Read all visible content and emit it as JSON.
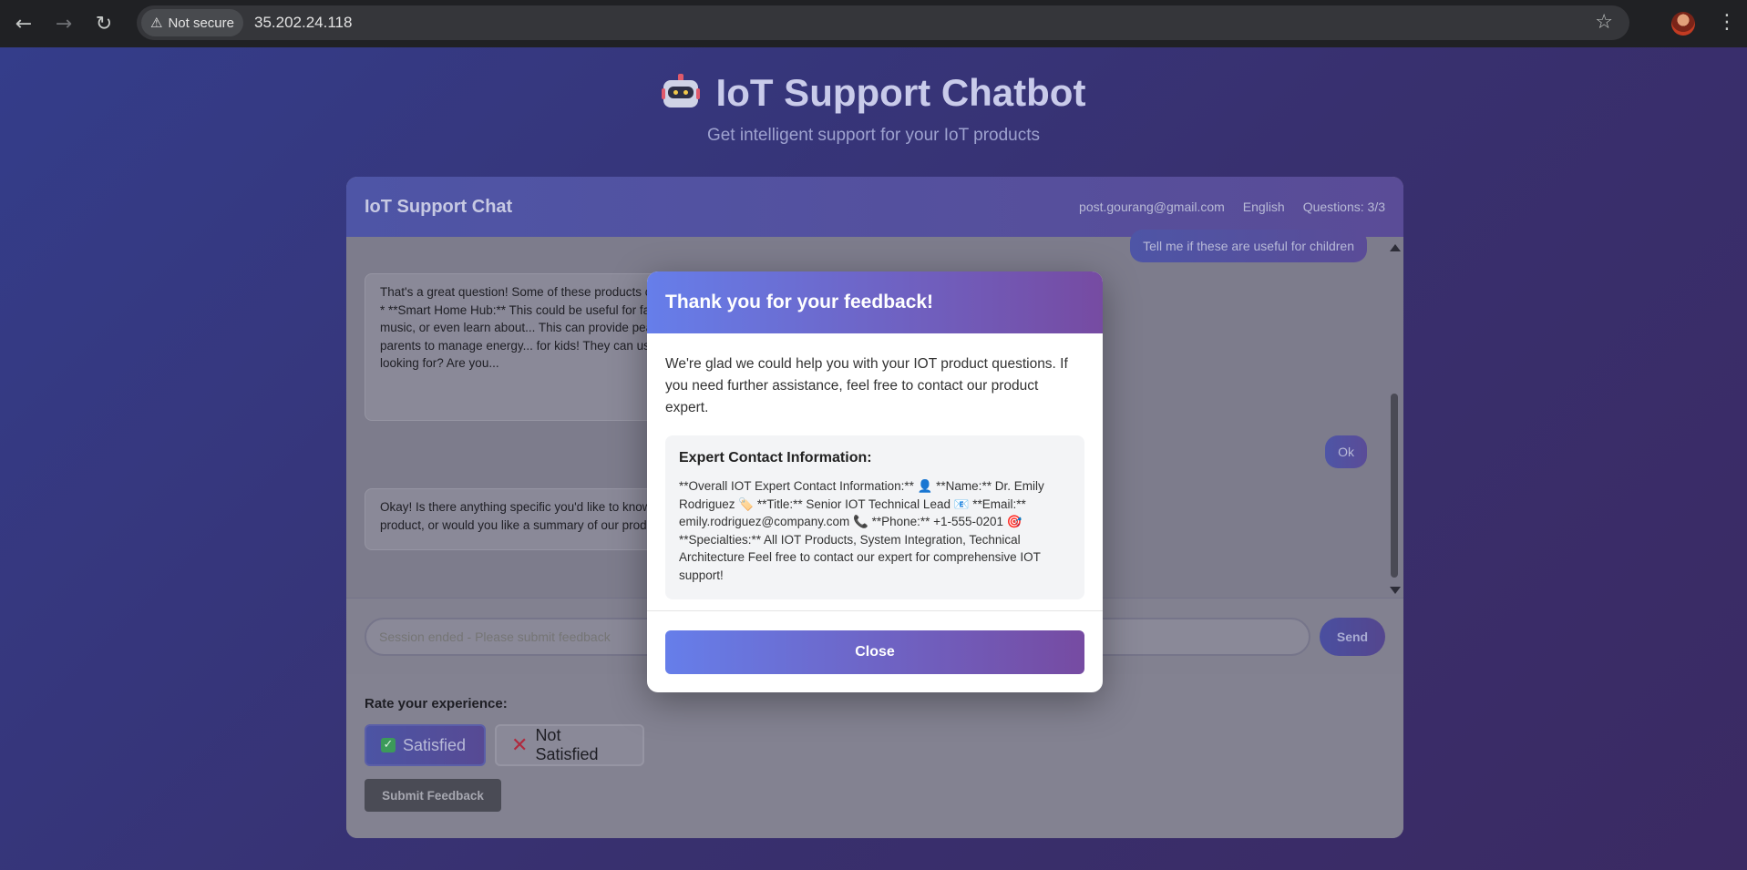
{
  "browser": {
    "security_label": "Not secure",
    "url": "35.202.24.118"
  },
  "app": {
    "title": "IoT Support Chatbot",
    "subtitle": "Get intelligent support for your IoT products"
  },
  "chat": {
    "title": "IoT Support Chat",
    "user_email": "post.gourang@gmail.com",
    "language": "English",
    "questions": "Questions: 3/3",
    "messages": [
      {
        "role": "user",
        "text": "Tell me if these are useful for children"
      },
      {
        "role": "bot",
        "text": "That's a great question! Some of these products can be useful for children depending on your family's needs. * **Smart Home Hub:** This could be useful for families with children - you could use it to control lights, music, or even learn about... This can provide peace of mind for parents, knowing... This is more useful for parents to manage energy... for kids! They can use voice commands to turn... me more about what you're looking for? Are you..."
      },
      {
        "role": "user",
        "text": "Ok"
      },
      {
        "role": "bot",
        "text": "Okay! Is there anything specific you'd like to know? Are you interested in learning more about a particular product, or would you like a summary of our products and their features again?"
      }
    ],
    "input_placeholder": "Session ended - Please submit feedback",
    "send_label": "Send"
  },
  "rating": {
    "label": "Rate your experience:",
    "satisfied_label": "Satisfied",
    "not_satisfied_label": "Not Satisfied",
    "submit_label": "Submit Feedback"
  },
  "modal": {
    "title": "Thank you for your feedback!",
    "message": "We're glad we could help you with your IOT product questions. If you need further assistance, feel free to contact our product expert.",
    "contact_title": "Expert Contact Information:",
    "contact_text": "**Overall IOT Expert Contact Information:** 👤 **Name:** Dr. Emily Rodriguez 🏷️ **Title:** Senior IOT Technical Lead 📧 **Email:** emily.rodriguez@company.com 📞 **Phone:** +1-555-0201 🎯 **Specialties:** All IOT Products, System Integration, Technical Architecture Feel free to contact our expert for comprehensive IOT support!",
    "close_label": "Close"
  }
}
